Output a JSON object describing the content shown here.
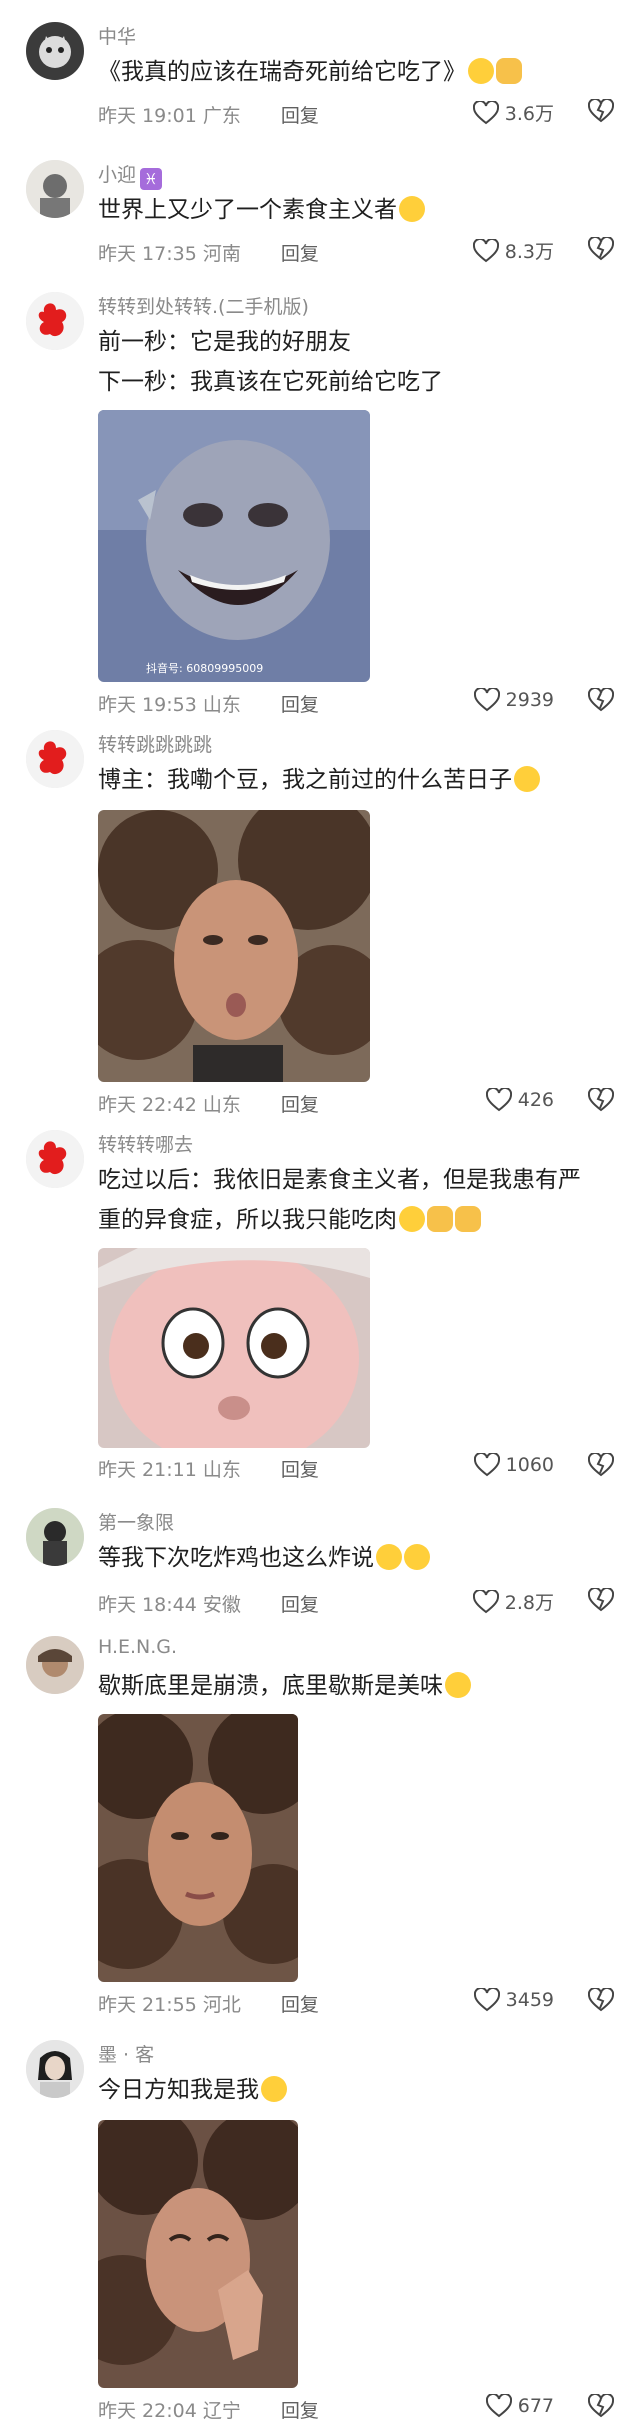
{
  "comments": [
    {
      "username": "中华",
      "text_lines": [
        "《我真的应该在瑞奇死前给它吃了》"
      ],
      "emojis": [
        "grin-emoji",
        "thumbs-up-emoji"
      ],
      "time": "昨天 19:01",
      "location": "广东",
      "reply": "回复",
      "likes": "3.6万"
    },
    {
      "username": "小迎",
      "username_badge": "♓",
      "text_lines": [
        "世界上又少了一个素食主义者"
      ],
      "emojis": [
        "hug-emoji"
      ],
      "time": "昨天 17:35",
      "location": "河南",
      "reply": "回复",
      "likes": "8.3万"
    },
    {
      "username": "转转到处转转.(二手机版)",
      "text_lines": [
        "前一秒：它是我的好朋友",
        "下一秒：我真该在它死前给它吃了"
      ],
      "media": {
        "kind": "image",
        "watermark": "抖音号: 60809995009"
      },
      "time": "昨天 19:53",
      "location": "山东",
      "reply": "回复",
      "likes": "2939"
    },
    {
      "username": "转转跳跳跳跳",
      "text_lines": [
        "博主：我嘞个豆，我之前过的什么苦日子"
      ],
      "emojis": [
        "cry-emoji"
      ],
      "media": {
        "kind": "image"
      },
      "time": "昨天 22:42",
      "location": "山东",
      "reply": "回复",
      "likes": "426"
    },
    {
      "username": "转转转哪去",
      "text_lines": [
        "吃过以后：我依旧是素食主义者，但是我患有严",
        "重的异食症，所以我只能吃肉"
      ],
      "emojis": [
        "grin-emoji",
        "ok-hand-emoji",
        "ok-hand-emoji"
      ],
      "media": {
        "kind": "image"
      },
      "time": "昨天 21:11",
      "location": "山东",
      "reply": "回复",
      "likes": "1060"
    },
    {
      "username": "第一象限",
      "text_lines": [
        "等我下次吃炸鸡也这么炸说"
      ],
      "emojis": [
        "grin-emoji",
        "grin-emoji"
      ],
      "time": "昨天 18:44",
      "location": "安徽",
      "reply": "回复",
      "likes": "2.8万"
    },
    {
      "username": "H.E.N.G.",
      "text_lines": [
        "歇斯底里是崩溃，底里歇斯是美味"
      ],
      "emojis": [
        "smile-emoji"
      ],
      "media": {
        "kind": "image"
      },
      "time": "昨天 21:55",
      "location": "河北",
      "reply": "回复",
      "likes": "3459"
    },
    {
      "username": "墨 · 客",
      "text_lines": [
        "今日方知我是我"
      ],
      "emojis": [
        "grin-emoji"
      ],
      "media": {
        "kind": "image"
      },
      "time": "昨天 22:04",
      "location": "辽宁",
      "reply": "回复",
      "likes": "677"
    }
  ],
  "icons": {
    "like": "heart-outline-icon",
    "dislike": "broken-heart-icon"
  },
  "colors": {
    "meta": "#8a8a8a",
    "text": "#1f1f1f",
    "background": "#ffffff"
  }
}
